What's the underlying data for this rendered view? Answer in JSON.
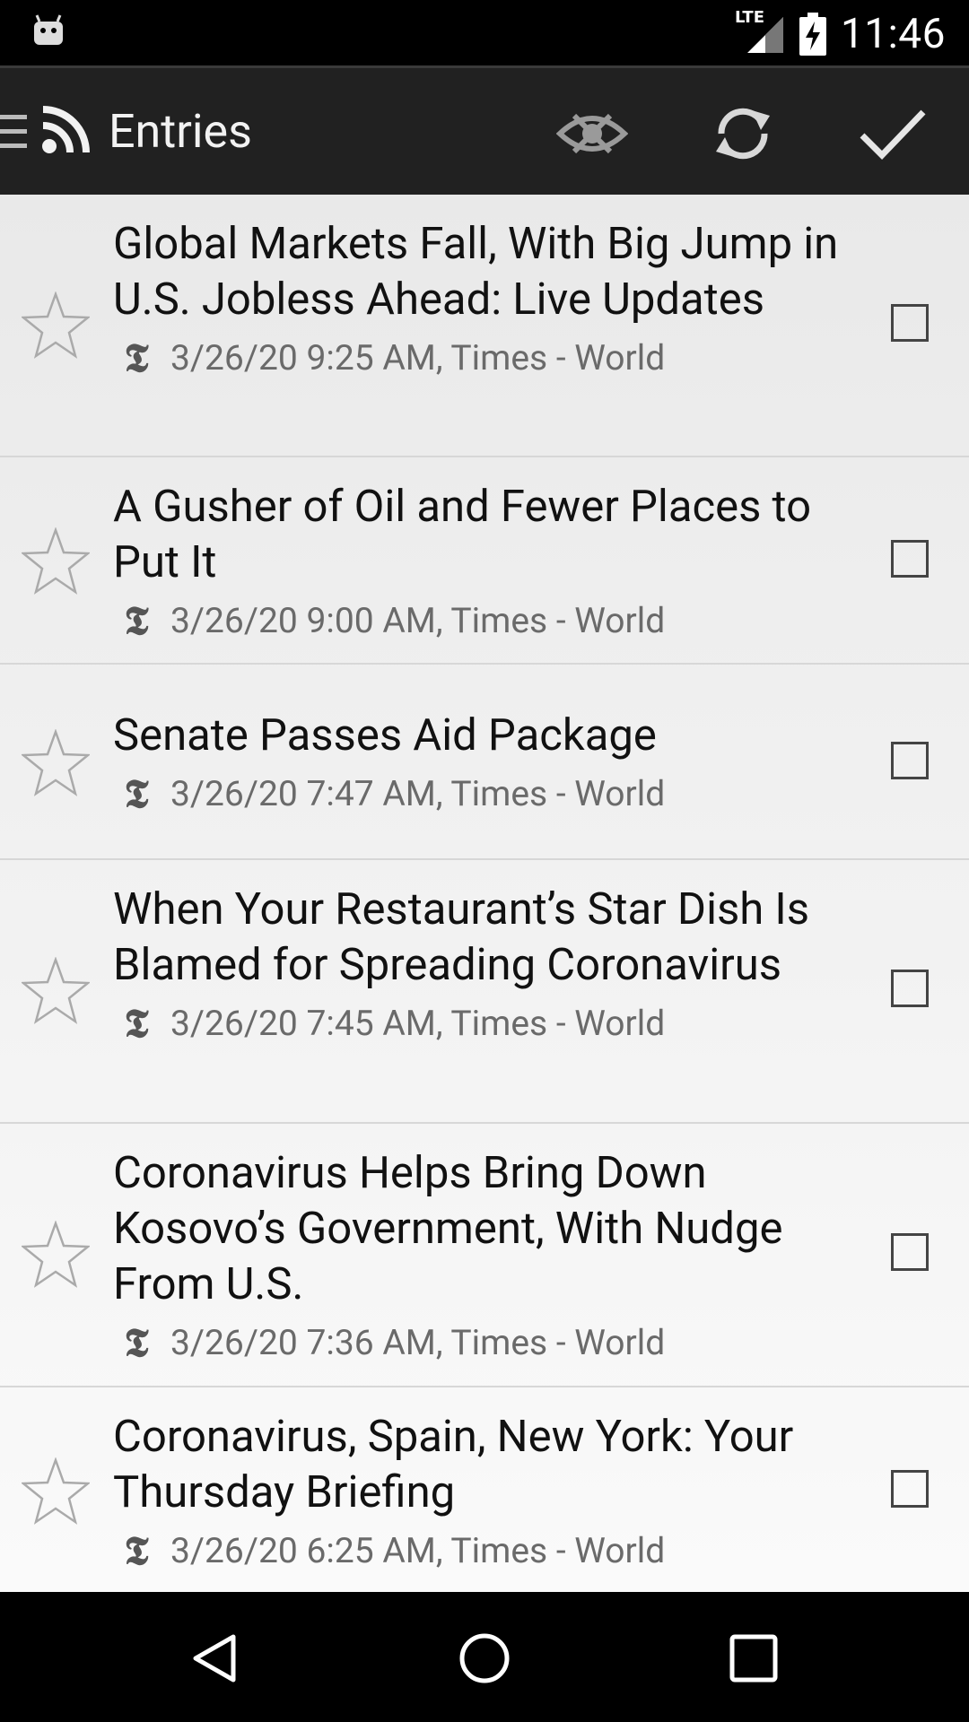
{
  "status_bar": {
    "network": "LTE",
    "time": "11:46",
    "icons": [
      "android-icon",
      "signal-icon",
      "battery-charging-icon"
    ]
  },
  "action_bar": {
    "title": "Entries",
    "icons": [
      "nav-drawer-icon",
      "rss-icon",
      "hide-read-icon",
      "refresh-icon",
      "mark-all-read-icon"
    ]
  },
  "entries": [
    {
      "title": "Global Markets Fall, With Big Jump in U.S. Jobless Ahead: Live Updates",
      "meta": "3/26/20 9:25 AM, Times - World",
      "starred": false,
      "checked": false
    },
    {
      "title": "A Gusher of Oil and Fewer Places to Put It",
      "meta": "3/26/20 9:00 AM, Times - World",
      "starred": false,
      "checked": false
    },
    {
      "title": "Senate Passes Aid Package",
      "meta": "3/26/20 7:47 AM, Times - World",
      "starred": false,
      "checked": false
    },
    {
      "title": "When Your Restaurant’s Star Dish Is Blamed for Spreading Coronavirus",
      "meta": "3/26/20 7:45 AM, Times - World",
      "starred": false,
      "checked": false
    },
    {
      "title": "Coronavirus Helps Bring Down Kosovo’s Government, With Nudge From U.S.",
      "meta": "3/26/20 7:36 AM, Times - World",
      "starred": false,
      "checked": false
    },
    {
      "title": "Coronavirus, Spain, New York: Your Thursday Briefing",
      "meta": "3/26/20 6:25 AM, Times - World",
      "starred": false,
      "checked": false
    }
  ],
  "feed_logo_glyph": "𝕿",
  "nav_bar": {
    "icons": [
      "back-icon",
      "home-icon",
      "recents-icon"
    ]
  }
}
